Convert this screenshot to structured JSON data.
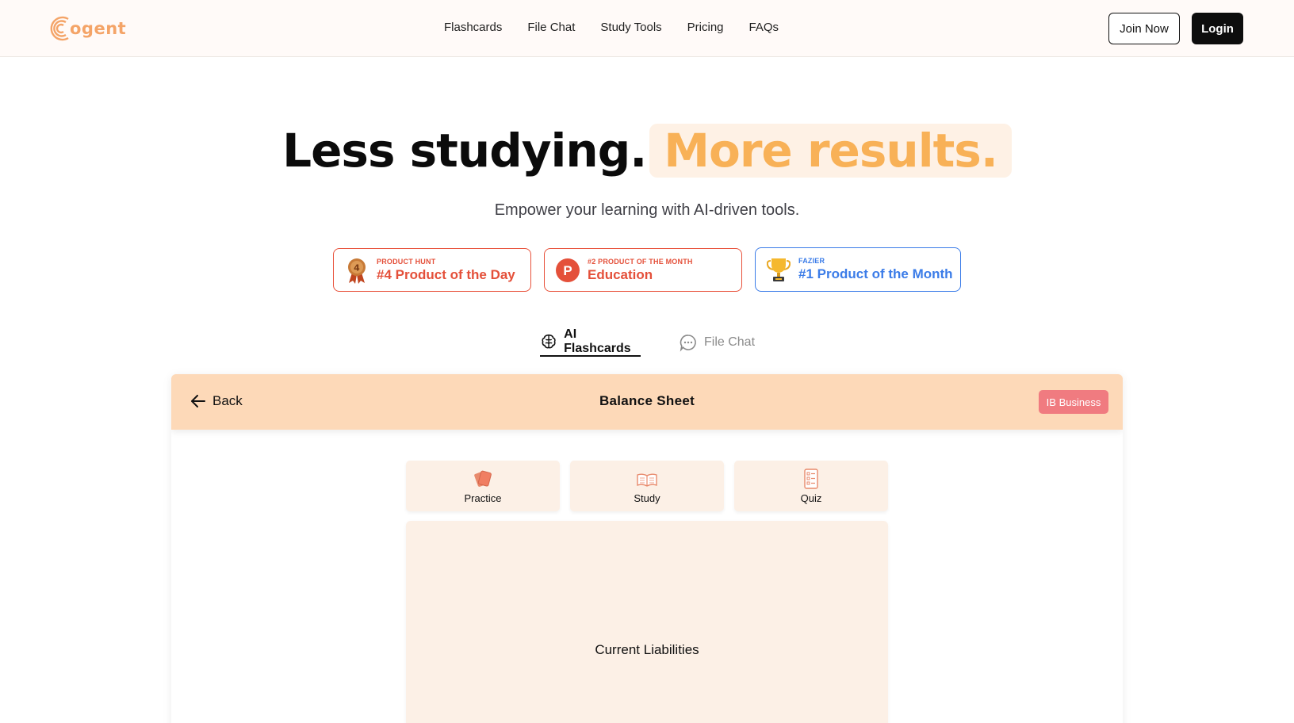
{
  "brand": {
    "name": "ogent",
    "accent": "#f4a468"
  },
  "nav": {
    "links": [
      "Flashcards",
      "File Chat",
      "Study Tools",
      "Pricing",
      "FAQs"
    ],
    "join_label": "Join Now",
    "login_label": "Login"
  },
  "hero": {
    "title_dark": "Less studying.",
    "title_highlight": "More results.",
    "subtitle": "Empower your learning with AI-driven tools."
  },
  "badges": [
    {
      "source": "PRODUCT HUNT",
      "title": "#4 Product of the Day",
      "icon": "medal-icon",
      "medal_number": "4",
      "color": "#e4503a"
    },
    {
      "source": "#2 PRODUCT OF THE MONTH",
      "title": "Education",
      "icon": "product-hunt-icon",
      "icon_letter": "P",
      "color": "#e4503a"
    },
    {
      "source": "FAZIER",
      "title": "#1 Product of the Month",
      "icon": "trophy-icon",
      "color": "#3b7ce8"
    }
  ],
  "tabs": [
    {
      "label": "AI Flashcards",
      "icon": "brain-icon",
      "active": true
    },
    {
      "label": "File Chat",
      "icon": "chat-bubble-icon",
      "active": false
    }
  ],
  "deck": {
    "back_label": "Back",
    "title": "Balance Sheet",
    "tag": "IB Business",
    "modes": [
      {
        "label": "Practice",
        "icon": "cards-icon"
      },
      {
        "label": "Study",
        "icon": "open-book-icon"
      },
      {
        "label": "Quiz",
        "icon": "checklist-icon"
      }
    ],
    "card_text": "Current Liabilities"
  }
}
